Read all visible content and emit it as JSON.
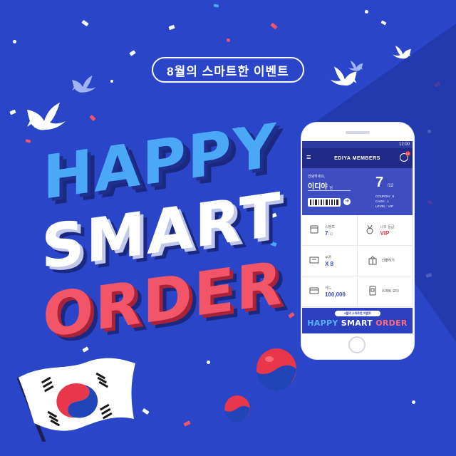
{
  "event_tag": "8월의 스마트한 이벤트",
  "headline": {
    "line1": "HAPPY",
    "line2": "SMART",
    "line3": "ORDER"
  },
  "colors": {
    "background": "#2a45c8",
    "happy": "#4aa8f6",
    "smart": "#ffffff",
    "order": "#f25468"
  },
  "phone": {
    "status_time": "12:00",
    "app_title": "EDIYA MEMBERS",
    "notification_count": "12",
    "member": {
      "greeting": "안녕하세요,",
      "name": "이디야",
      "honorific": "님",
      "stamp_count": "7",
      "stamp_total": "/12",
      "coupon": "COUPON : 8",
      "cash": "CASH : 1",
      "level": "LEVEL : VIP"
    },
    "tiles": [
      {
        "icon": "stamp-card-icon",
        "label": "스탬프",
        "value": "7",
        "sub": "/12"
      },
      {
        "icon": "medal-icon",
        "label": "나의 등급",
        "value": "VIP",
        "sub": ""
      },
      {
        "icon": "coupon-icon",
        "label": "쿠폰",
        "value": "X 8",
        "sub": ""
      },
      {
        "icon": "gift-box-icon",
        "label": "선물하기",
        "value": "",
        "sub": ""
      },
      {
        "icon": "card-icon",
        "label": "카드",
        "value": "100,000",
        "sub": ""
      },
      {
        "icon": "phone-order-icon",
        "label": "스마트 오더",
        "value": "",
        "sub": ""
      }
    ],
    "banner": {
      "tag": "8월의 스마트한 이벤트",
      "happy": "HAPPY",
      "smart": "SMART",
      "order": "ORDER"
    }
  }
}
